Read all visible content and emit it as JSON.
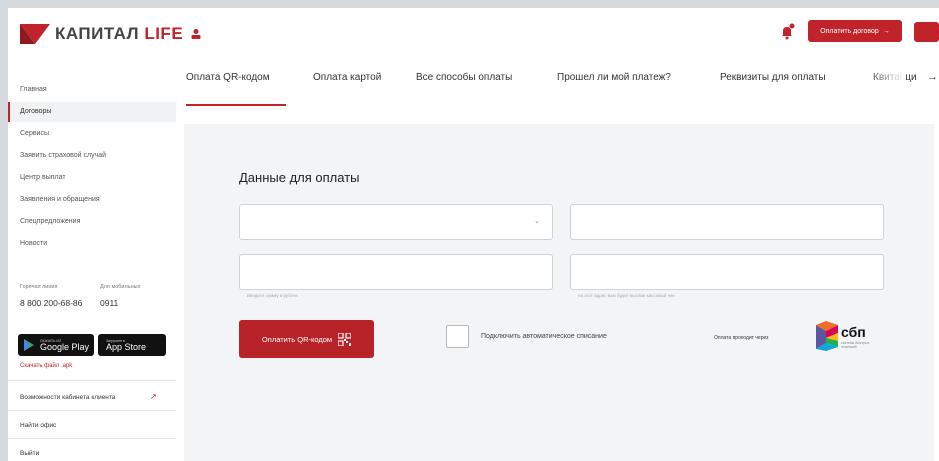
{
  "header": {
    "logo_main": "КАПИТАЛ ",
    "logo_accent": "LIFE",
    "pay_contract": "Оплатить договор",
    "pay_contract_arrow": "→"
  },
  "sidebar": {
    "items": [
      {
        "label": "Главная"
      },
      {
        "label": "Договоры"
      },
      {
        "label": "Сервисы"
      },
      {
        "label": "Заявить страховой случай"
      },
      {
        "label": "Центр выплат"
      },
      {
        "label": "Заявления и обращения"
      },
      {
        "label": "Спецпредложения"
      },
      {
        "label": "Новости"
      }
    ],
    "active_index": 1,
    "hotline_label": "Горячая линия",
    "hotline_phone": "8 800 200-68-86",
    "mobile_label": "Для мобильных",
    "mobile_phone": "0911",
    "google_play_small": "СКАЧАТЬ ИЗ",
    "google_play": "Google Play",
    "app_store_small": "Загрузите в",
    "app_store": "App Store",
    "apk_link": "Скачать файл .apk",
    "cabinet_features": "Возможности кабинета клиента",
    "find_office": "Найти офис",
    "logout": "Выйти"
  },
  "tabs": [
    {
      "label": "Оплата QR-кодом"
    },
    {
      "label": "Оплата картой"
    },
    {
      "label": "Все способы оплаты"
    },
    {
      "label": "Прошел ли мой платеж?"
    },
    {
      "label": "Реквизиты для оплаты"
    },
    {
      "label": "Квитанция"
    }
  ],
  "tab_next_arrow": "→",
  "form": {
    "title": "Данные для оплаты",
    "dropdown_caret": "⌄",
    "amount_hint": "Введите сумму в рублях",
    "email_hint": "на этот адрес вам будет выслан кассовый чек",
    "qr_button": "Оплатить QR-кодом",
    "autopay_label": "Подключить автоматическое списание",
    "sbp_via": "Оплата проходит через",
    "sbp_text": "сбп",
    "sbp_sub": "система быстрых платежей"
  },
  "colors": {
    "accent": "#c1232b",
    "panel_bg": "#f3f4f6"
  }
}
